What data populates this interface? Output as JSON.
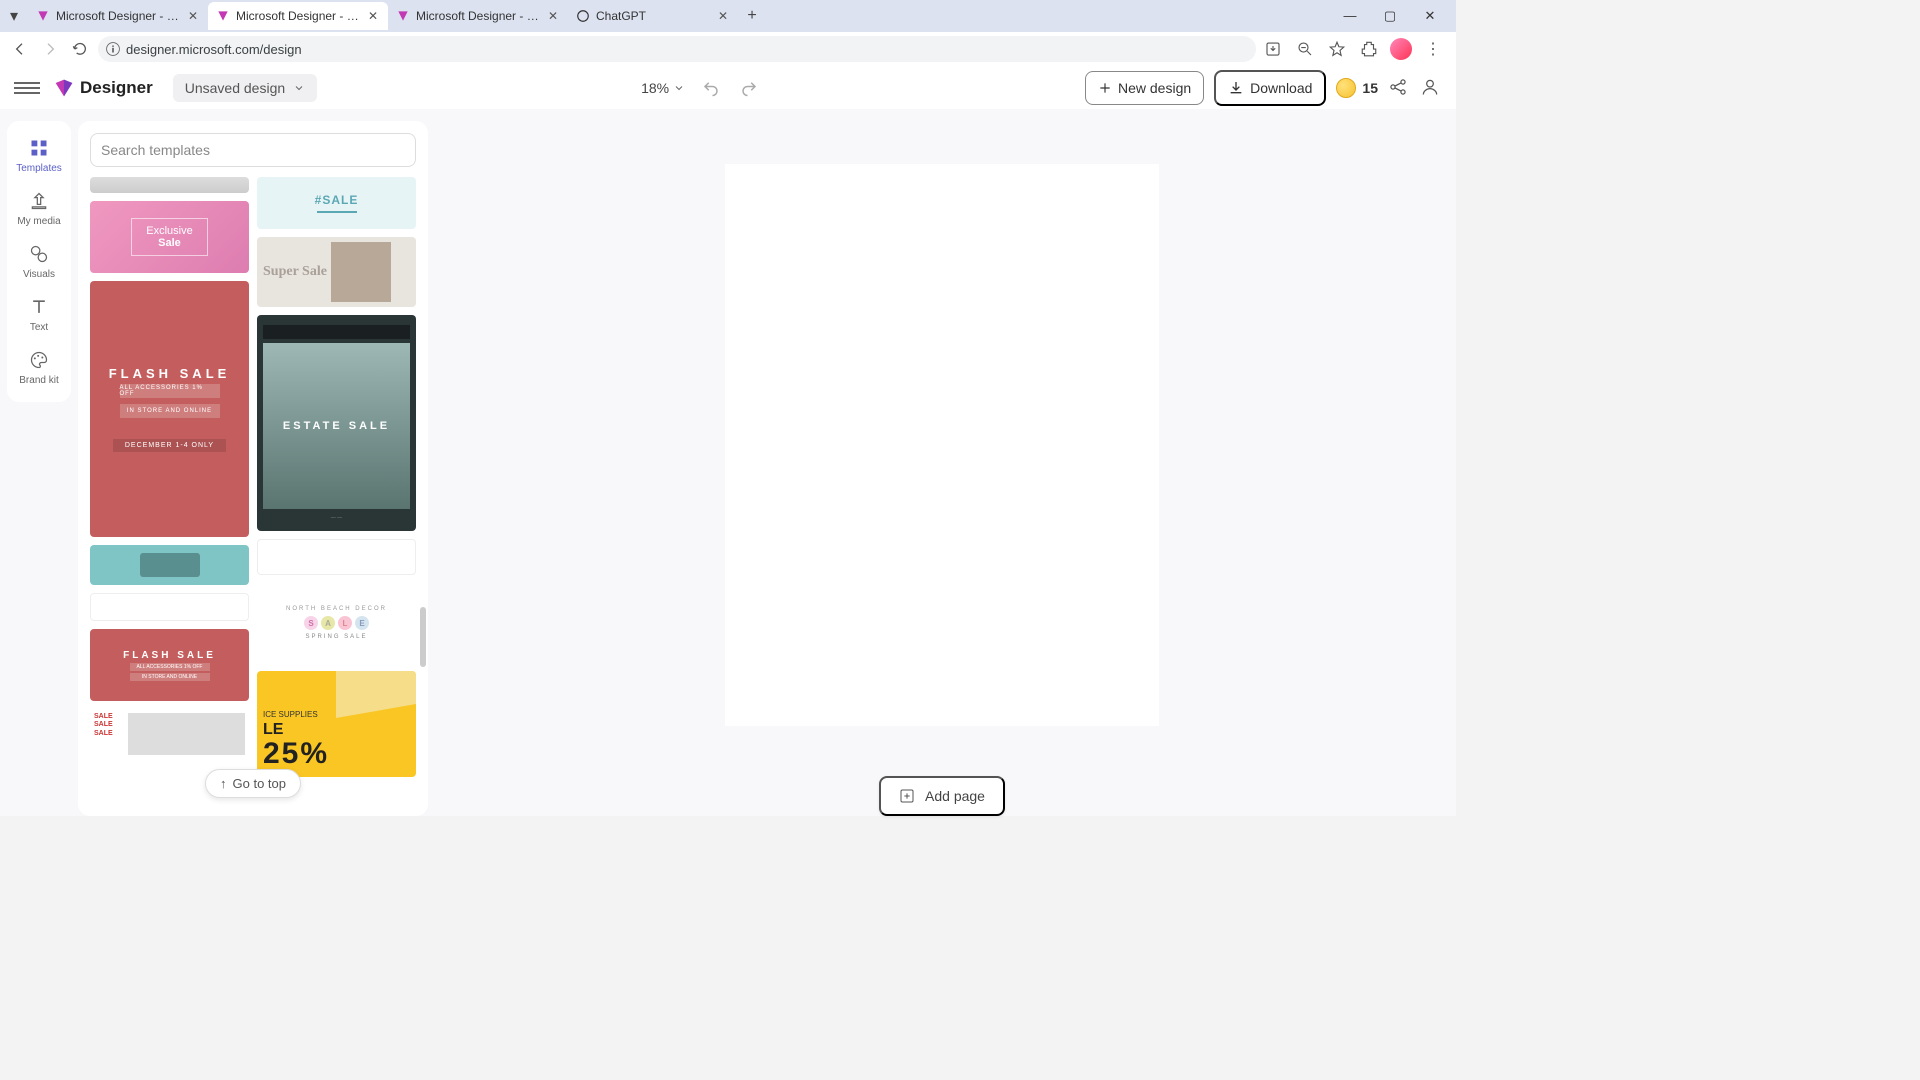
{
  "browser": {
    "tabs": [
      {
        "title": "Microsoft Designer - Stunning",
        "active": false
      },
      {
        "title": "Microsoft Designer - Stunning",
        "active": true
      },
      {
        "title": "Microsoft Designer - Stunning",
        "active": false
      },
      {
        "title": "ChatGPT",
        "active": false
      }
    ],
    "url": "designer.microsoft.com/design"
  },
  "header": {
    "logo_text": "Designer",
    "doc_name": "Unsaved design",
    "zoom": "18%",
    "new_design_label": "New design",
    "download_label": "Download",
    "credits": "15"
  },
  "rail": {
    "templates": "Templates",
    "my_media": "My media",
    "visuals": "Visuals",
    "text": "Text",
    "brand_kit": "Brand kit"
  },
  "panel": {
    "search_placeholder": "Search templates",
    "go_to_top": "Go to top"
  },
  "templates": {
    "exclusive_l1": "Exclusive",
    "exclusive_l2": "Sale",
    "flash_title": "FLASH SALE",
    "flash_sub1": "ALL ACCESSORIES 1% OFF",
    "flash_sub2": "IN STORE AND ONLINE",
    "flash_btn": "DECEMBER 1-4 ONLY",
    "flash2_title": "FLASH SALE",
    "flash2_sub1": "ALL ACCESSORIES 1% OFF",
    "flash2_sub2": "IN STORE AND ONLINE",
    "salesalesale": "SALE\nSALE\nSALE",
    "hashtag": "#SALE",
    "super": "Super Sale",
    "estate_title": "ESTATE SALE",
    "spring_header": "NORTH BEACH DECOR",
    "spring_s": "S",
    "spring_a": "A",
    "spring_l": "L",
    "spring_e": "E",
    "spring_sub": "SPRING SALE",
    "yellow_sub": "ICE SUPPLIES",
    "yellow_title": "LE",
    "yellow_big": "25%"
  },
  "canvas": {
    "add_page": "Add page"
  }
}
